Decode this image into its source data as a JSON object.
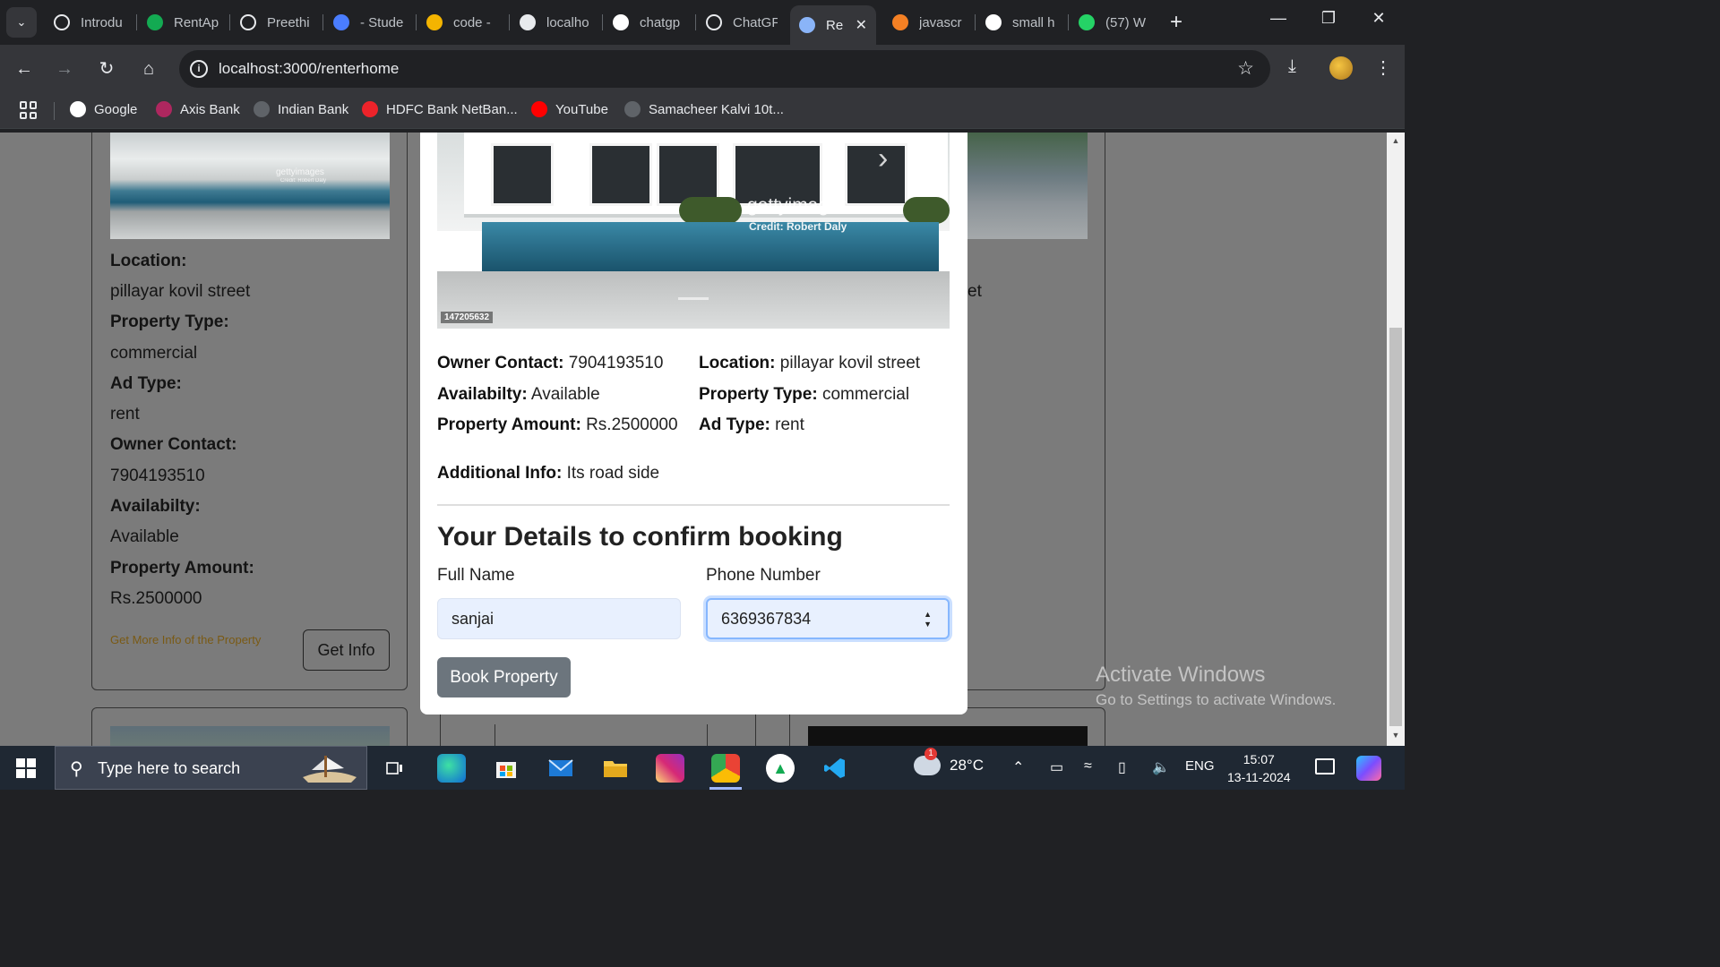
{
  "browser": {
    "tabs": [
      {
        "title": "Introdu",
        "icon": "chatgpt-icon",
        "color": "#202124"
      },
      {
        "title": "RentAp",
        "icon": "leaf-icon",
        "color": "#13aa52"
      },
      {
        "title": "Preethi",
        "icon": "github-icon",
        "color": "#202124"
      },
      {
        "title": "- Stude",
        "icon": "monitor-icon",
        "color": "#4a7dff"
      },
      {
        "title": "code -",
        "icon": "google-drive-icon",
        "color": "#f4b400"
      },
      {
        "title": "localho",
        "icon": "home-icon",
        "color": "#e8eaed"
      },
      {
        "title": "chatgp",
        "icon": "google-icon",
        "color": "#ffffff"
      },
      {
        "title": "ChatGF",
        "icon": "chatgpt-icon",
        "color": "#202124"
      },
      {
        "title": "Re",
        "icon": "home-icon",
        "color": "#8ab4f8",
        "active": true
      },
      {
        "title": "javascr",
        "icon": "stackoverflow-icon",
        "color": "#f48024"
      },
      {
        "title": "small h",
        "icon": "google-icon",
        "color": "#ffffff"
      },
      {
        "title": "(57) W",
        "icon": "whatsapp-icon",
        "color": "#25d366"
      }
    ],
    "url_host": "localhost",
    "url_rest": ":3000/renterhome",
    "bookmarks": [
      {
        "label": "Google",
        "icon": "google-icon",
        "color": "#ffffff"
      },
      {
        "label": "Axis Bank",
        "icon": "axis-bank-icon",
        "color": "#ae275f"
      },
      {
        "label": "Indian Bank",
        "icon": "globe-icon",
        "color": "#5f6368"
      },
      {
        "label": "HDFC Bank NetBan...",
        "icon": "hdfc-icon",
        "color": "#ed232a"
      },
      {
        "label": "YouTube",
        "icon": "youtube-icon",
        "color": "#ff0000"
      },
      {
        "label": "Samacheer Kalvi 10t...",
        "icon": "globe-icon",
        "color": "#5f6368"
      }
    ]
  },
  "background_card": {
    "location_label": "Location:",
    "location_value": "pillayar kovil street",
    "type_label": "Property Type:",
    "type_value": "commercial",
    "ad_label": "Ad Type:",
    "ad_value": "rent",
    "contact_label": "Owner Contact:",
    "contact_value": "7904193510",
    "avail_label": "Availabilty:",
    "avail_value": "Available",
    "amount_label": "Property Amount:",
    "amount_value": "Rs.2500000",
    "more_info_link": "Get More Info of the Property",
    "get_info_button": "Get Info",
    "img_watermark": "gettyimages",
    "img_credit": "Credit: Robert Daly",
    "right_fragment": "et"
  },
  "modal": {
    "image": {
      "watermark": "gettyimages",
      "credit": "Credit: Robert Daly",
      "image_id": "147205632"
    },
    "owner_contact_label": "Owner Contact:",
    "owner_contact": "7904193510",
    "location_label": "Location:",
    "location": "pillayar kovil street",
    "availability_label": "Availabilty:",
    "availability": "Available",
    "property_type_label": "Property Type:",
    "property_type": "commercial",
    "amount_label": "Property Amount:",
    "amount": "Rs.2500000",
    "ad_type_label": "Ad Type:",
    "ad_type": "rent",
    "additional_info_label": "Additional Info:",
    "additional_info": "Its road side",
    "booking_title": "Your Details to confirm booking",
    "full_name_label": "Full Name",
    "full_name_value": "sanjai",
    "phone_label": "Phone Number",
    "phone_value": "6369367834",
    "book_button": "Book Property"
  },
  "watermark": {
    "line1": "Activate Windows",
    "line2": "Go to Settings to activate Windows."
  },
  "taskbar": {
    "search_placeholder": "Type here to search",
    "temperature": "28°C",
    "weather_badge": "1",
    "language": "ENG",
    "time": "15:07",
    "date": "13-11-2024"
  }
}
